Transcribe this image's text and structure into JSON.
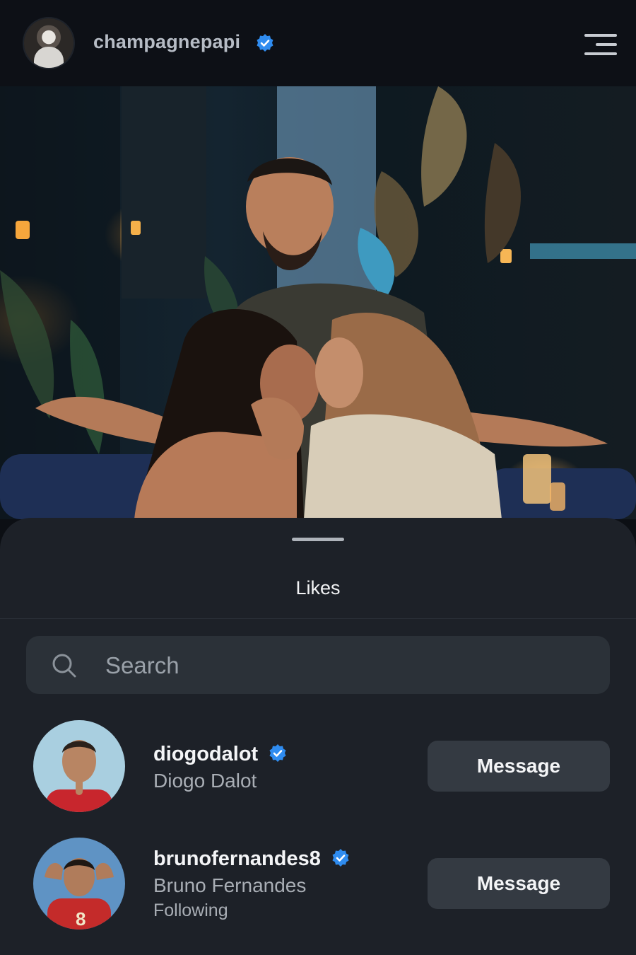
{
  "header": {
    "username": "champagnepapi",
    "verified": true,
    "avatar_icon": "avatar-image",
    "menu_icon": "hamburger-menu-icon"
  },
  "post": {
    "image": "photo-of-three-people-nightclub"
  },
  "sheet": {
    "title": "Likes",
    "search": {
      "placeholder": "Search",
      "value": ""
    },
    "likes": [
      {
        "username": "diogodalot",
        "full_name": "Diogo Dalot",
        "subtitle": "",
        "verified": true,
        "button_label": "Message",
        "avatar_bg": "#a9cfe0"
      },
      {
        "username": "brunofernandes8",
        "full_name": "Bruno Fernandes",
        "subtitle": "Following",
        "verified": true,
        "button_label": "Message",
        "avatar_bg": "#5f93c4"
      }
    ]
  },
  "colors": {
    "background": "#0c0f14",
    "sheet": "#1d2128",
    "button": "#343a42",
    "verified_blue": "#2f8cf0",
    "search_field": "#2b3138"
  }
}
